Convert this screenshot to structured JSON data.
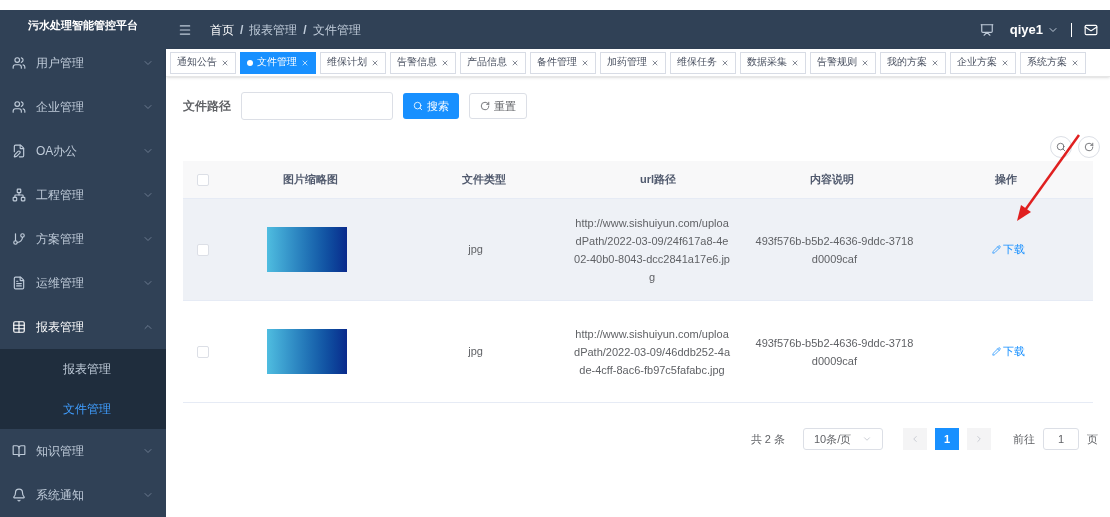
{
  "sidebar": {
    "title": "污水处理智能管控平台",
    "items": [
      {
        "label": "用户管理",
        "expanded": false
      },
      {
        "label": "企业管理",
        "expanded": false
      },
      {
        "label": "OA办公",
        "expanded": false
      },
      {
        "label": "工程管理",
        "expanded": false
      },
      {
        "label": "方案管理",
        "expanded": false
      },
      {
        "label": "运维管理",
        "expanded": false
      },
      {
        "label": "报表管理",
        "expanded": true,
        "children": [
          {
            "label": "报表管理",
            "selected": false
          },
          {
            "label": "文件管理",
            "selected": true
          }
        ]
      },
      {
        "label": "知识管理",
        "expanded": false
      },
      {
        "label": "系统通知",
        "expanded": false
      }
    ]
  },
  "header": {
    "breadcrumb": [
      "首页",
      "/",
      "报表管理",
      "/",
      "文件管理"
    ],
    "user": "qiye1"
  },
  "tabs": [
    {
      "label": "通知公告",
      "selected": false
    },
    {
      "label": "文件管理",
      "selected": true
    },
    {
      "label": "维保计划",
      "selected": false
    },
    {
      "label": "告警信息",
      "selected": false
    },
    {
      "label": "产品信息",
      "selected": false
    },
    {
      "label": "备件管理",
      "selected": false
    },
    {
      "label": "加药管理",
      "selected": false
    },
    {
      "label": "维保任务",
      "selected": false
    },
    {
      "label": "数据采集",
      "selected": false
    },
    {
      "label": "告警规则",
      "selected": false
    },
    {
      "label": "我的方案",
      "selected": false
    },
    {
      "label": "企业方案",
      "selected": false
    },
    {
      "label": "系统方案",
      "selected": false
    }
  ],
  "search": {
    "label": "文件路径",
    "search_button": "搜索",
    "reset_button": "重置"
  },
  "table": {
    "all_checked": false,
    "columns": [
      "图片缩略图",
      "文件类型",
      "url路径",
      "内容说明",
      "操作"
    ],
    "rows": [
      {
        "checked": false,
        "highlighted": true,
        "type": "jpg",
        "url": "http://www.sishuiyun.com/uploadPath/2022-03-09/24f617a8-4e02-40b0-8043-dcc2841a17e6.jpg",
        "description": "493f576b-b5b2-4636-9ddc-3718d0009caf",
        "action": "下载"
      },
      {
        "checked": false,
        "highlighted": false,
        "type": "jpg",
        "url": "http://www.sishuiyun.com/uploadPath/2022-03-09/46ddb252-4ade-4cff-8ac6-fb97c5fafabc.jpg",
        "description": "493f576b-b5b2-4636-9ddc-3718d0009caf",
        "action": "下载"
      }
    ]
  },
  "pagination": {
    "total": "共 2 条",
    "page_size": "10条/页",
    "pages": [
      {
        "label": "1",
        "selected": true
      }
    ],
    "goto_label": "前往",
    "goto_value": "1",
    "page_unit": "页"
  }
}
